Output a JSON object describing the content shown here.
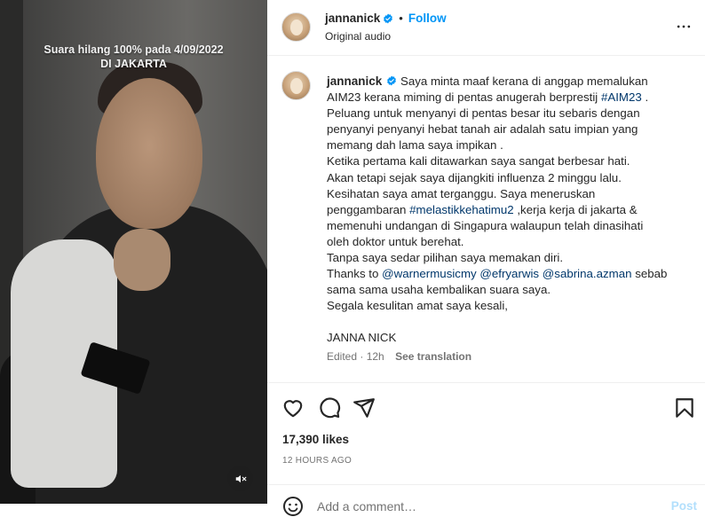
{
  "video": {
    "caption": "Suara hilang 100% pada  4/09/2022\nDI JAKARTA",
    "mute_icon": "speaker-muted-icon"
  },
  "header": {
    "username": "jannanick",
    "separator": "•",
    "follow_label": "Follow",
    "audio_label": "Original audio",
    "more_icon": "more-options-icon"
  },
  "caption": {
    "username": "jannanick",
    "lines": [
      [
        "Saya minta maaf kerana di anggap memalukan"
      ],
      [
        "AIM23 kerana miming di pentas anugerah berprestij ",
        "#AIM23",
        " ."
      ],
      [
        "Peluang untuk menyanyi di pentas besar itu sebaris dengan"
      ],
      [
        "penyanyi penyanyi hebat tanah air adalah satu impian yang"
      ],
      [
        "memang dah lama saya impikan ."
      ],
      [
        "Ketika pertama kali ditawarkan saya sangat berbesar hati."
      ],
      [
        "Akan tetapi sejak saya dijangkiti influenza 2 minggu lalu."
      ],
      [
        "Kesihatan saya amat terganggu. Saya meneruskan"
      ],
      [
        "penggambaran ",
        "#melastikkehatimu2",
        " ,kerja kerja di jakarta &"
      ],
      [
        "memenuhi undangan di Singapura walaupun telah dinasihati"
      ],
      [
        "oleh doktor untuk berehat."
      ],
      [
        "Tanpa saya sedar pilihan saya memakan diri."
      ],
      [
        "Thanks to ",
        "@warnermusicmy",
        " ",
        "@efryarwis",
        " ",
        "@sabrina.azman",
        " sebab"
      ],
      [
        "sama sama usaha kembalikan suara saya."
      ],
      [
        "Segala kesulitan amat saya kesali,"
      ],
      [
        ""
      ],
      [
        "JANNA NICK"
      ]
    ],
    "edited": "Edited · 12h",
    "see_translation": "See translation"
  },
  "actions": {
    "like_icon": "heart-icon",
    "comment_icon": "comment-icon",
    "share_icon": "send-icon",
    "save_icon": "bookmark-icon"
  },
  "likes": "17,390 likes",
  "time_ago": "12 HOURS AGO",
  "comment": {
    "emoji_icon": "emoji-icon",
    "placeholder": "Add a comment…",
    "post_label": "Post"
  },
  "colors": {
    "link": "#0095f6",
    "hashtag": "#00376b",
    "post_disabled": "#b2dffc",
    "muted_text": "#737373"
  }
}
